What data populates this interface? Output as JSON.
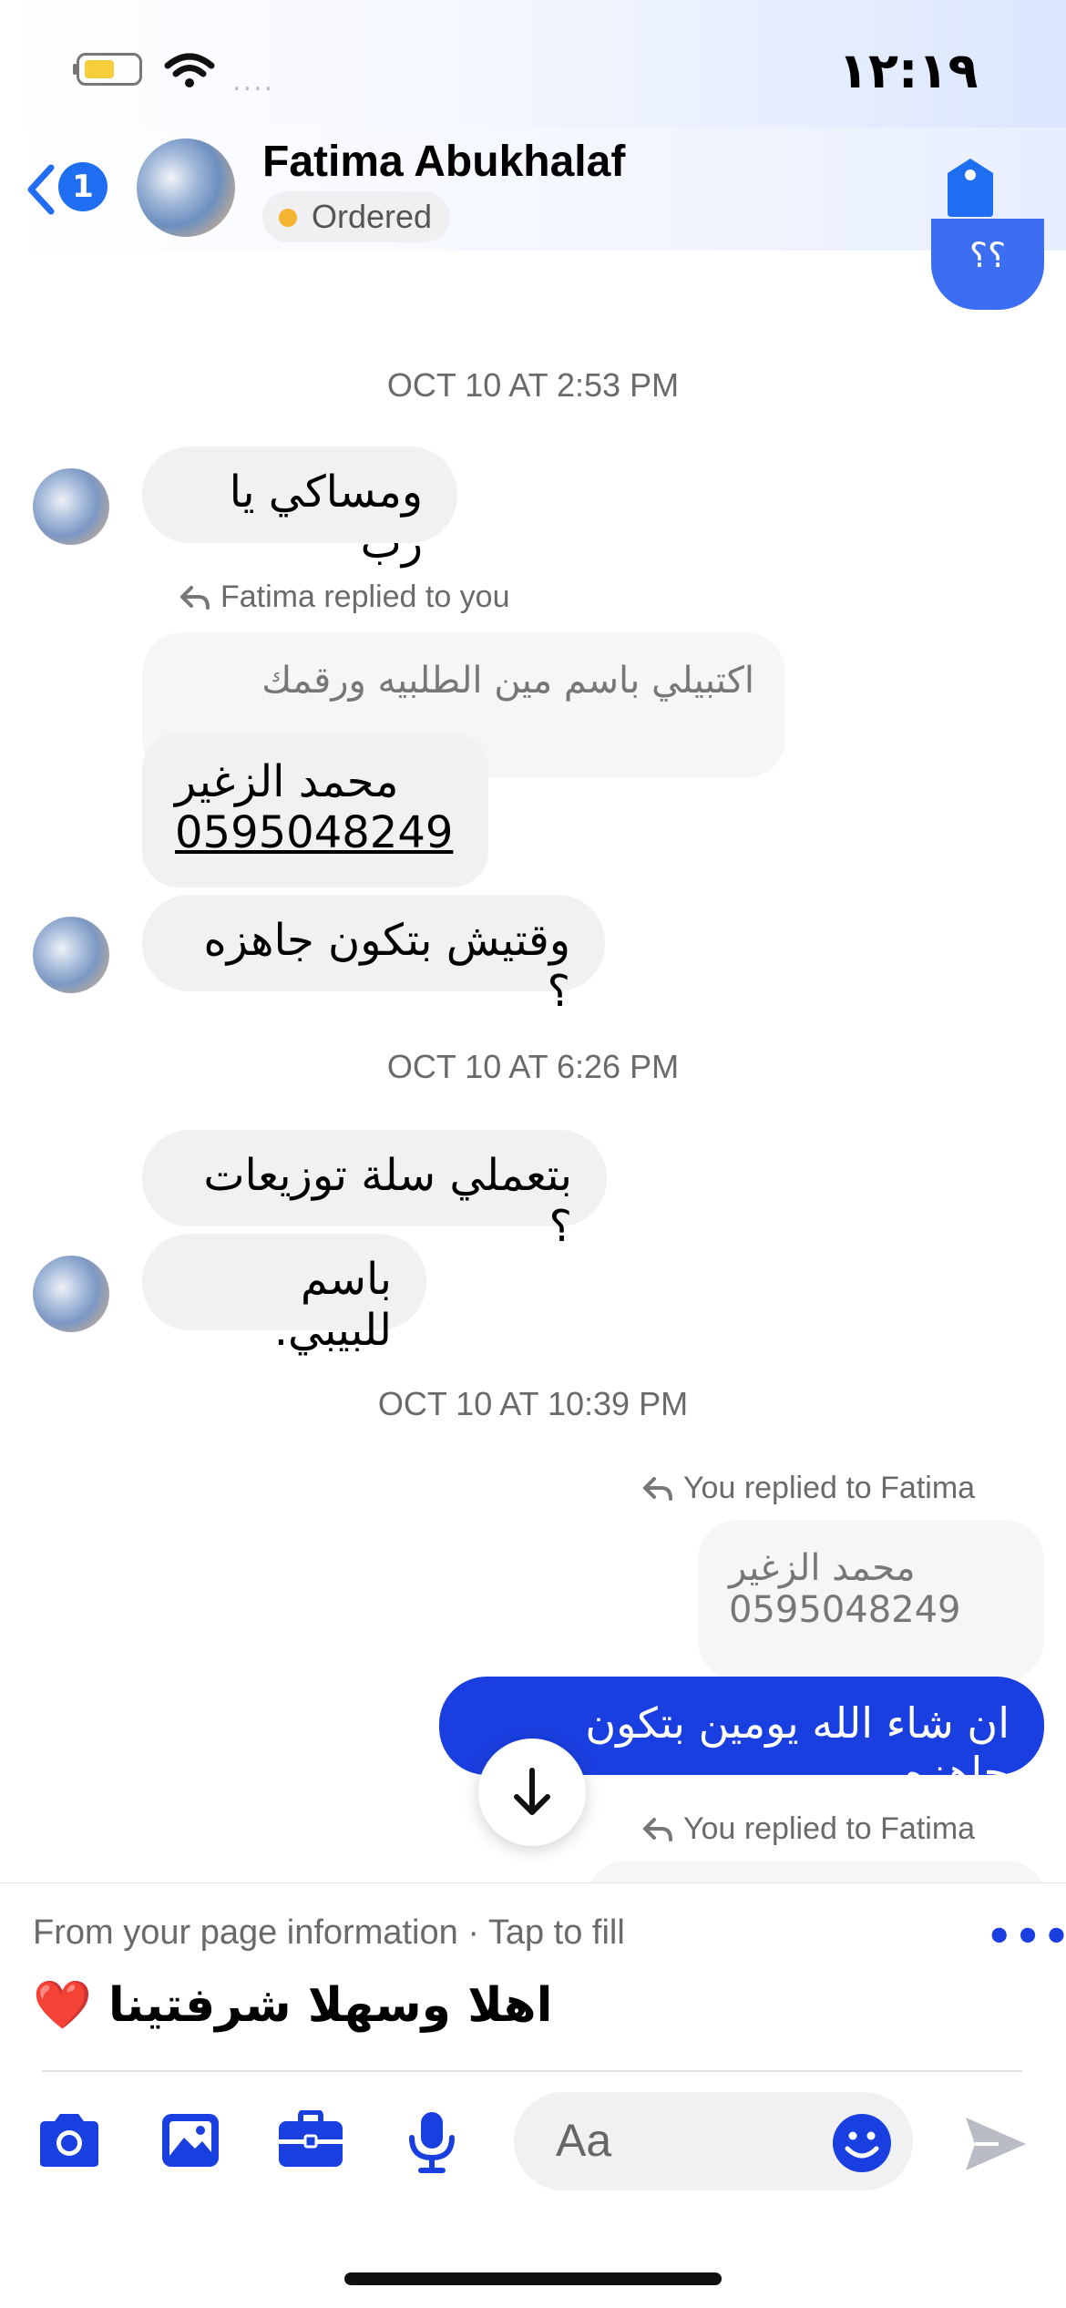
{
  "status_bar": {
    "time": "١٢:١٩",
    "signal": "...."
  },
  "header": {
    "back_count": "1",
    "contact_name": "Fatima Abukhalaf",
    "status_label": "Ordered",
    "partial_bubble_text": "؟؟"
  },
  "messages": {
    "ts1": "OCT 10 AT 2:53 PM",
    "m1": "ومساكي يا رب",
    "reply1_label": "Fatima replied to you",
    "reply1_quote": "اكتبيلي باسم مين الطلبيه ورقمك",
    "m2_line1": "محمد الزغير",
    "m2_line2": "0595048249",
    "m3": "وقتيش بتكون جاهزه ؟",
    "ts2": "OCT 10 AT 6:26 PM",
    "m4": "بتعملي سلة توزيعات ؟",
    "m5": "باسم للبيبي.",
    "ts3": "OCT 10 AT 10:39 PM",
    "reply2_label": "You replied to Fatima",
    "reply2_quote_line1": "محمد الزغير",
    "reply2_quote_line2": "0595048249",
    "m6": "ان شاء الله يومين بتكون جاهزه",
    "reply3_label": "You replied to Fatima"
  },
  "composer": {
    "fill_hint": "From your page information · Tap to fill",
    "suggestion_text": "اهلا وسهلا شرفتينا",
    "suggestion_emoji": "❤️",
    "more": "•••",
    "placeholder": "Aa"
  },
  "colors": {
    "accent": "#1f6ef2",
    "outgoing_bubble": "#1a3fe0",
    "incoming_bubble": "#f1f1f3",
    "status_dot": "#f6b531"
  },
  "icons": [
    "back-chevron-icon",
    "tag-icon",
    "reply-arrow-icon",
    "arrow-down-icon",
    "camera-icon",
    "image-icon",
    "briefcase-icon",
    "microphone-icon",
    "emoji-icon",
    "send-icon",
    "wifi-icon",
    "battery-icon"
  ]
}
